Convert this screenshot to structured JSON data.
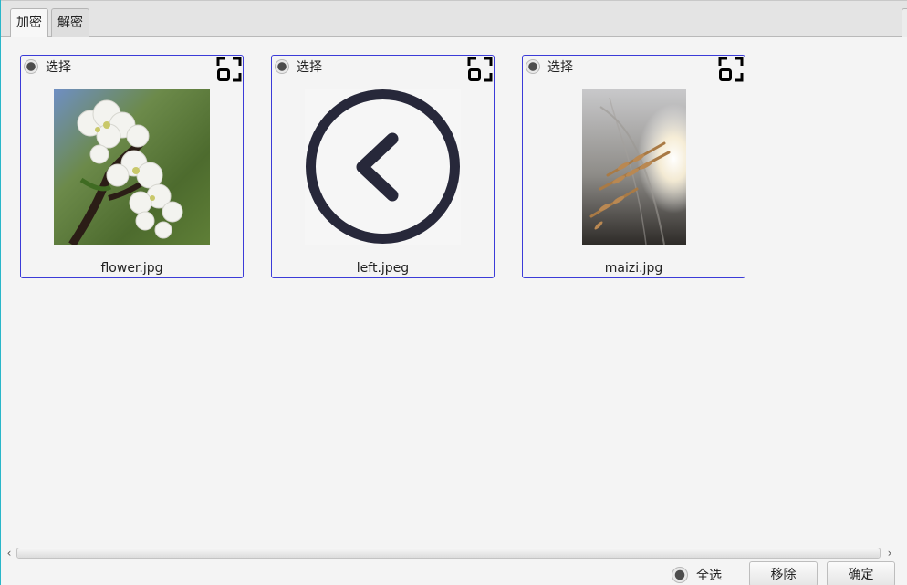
{
  "tabs": [
    {
      "label": "加密",
      "active": true
    },
    {
      "label": "解密",
      "active": false
    }
  ],
  "cards": [
    {
      "select_label": "选择",
      "filename": "flower.jpg",
      "image": "white-blossom-photo"
    },
    {
      "select_label": "选择",
      "filename": "left.jpeg",
      "image": "left-arrow-circle-icon"
    },
    {
      "select_label": "选择",
      "filename": "maizi.jpg",
      "image": "wheat-sunlight-photo"
    }
  ],
  "bottom": {
    "select_all_label": "全选",
    "remove_label": "移除",
    "confirm_label": "确定"
  },
  "colors": {
    "card_border": "#3b3bd8",
    "background": "#f4f4f4"
  }
}
